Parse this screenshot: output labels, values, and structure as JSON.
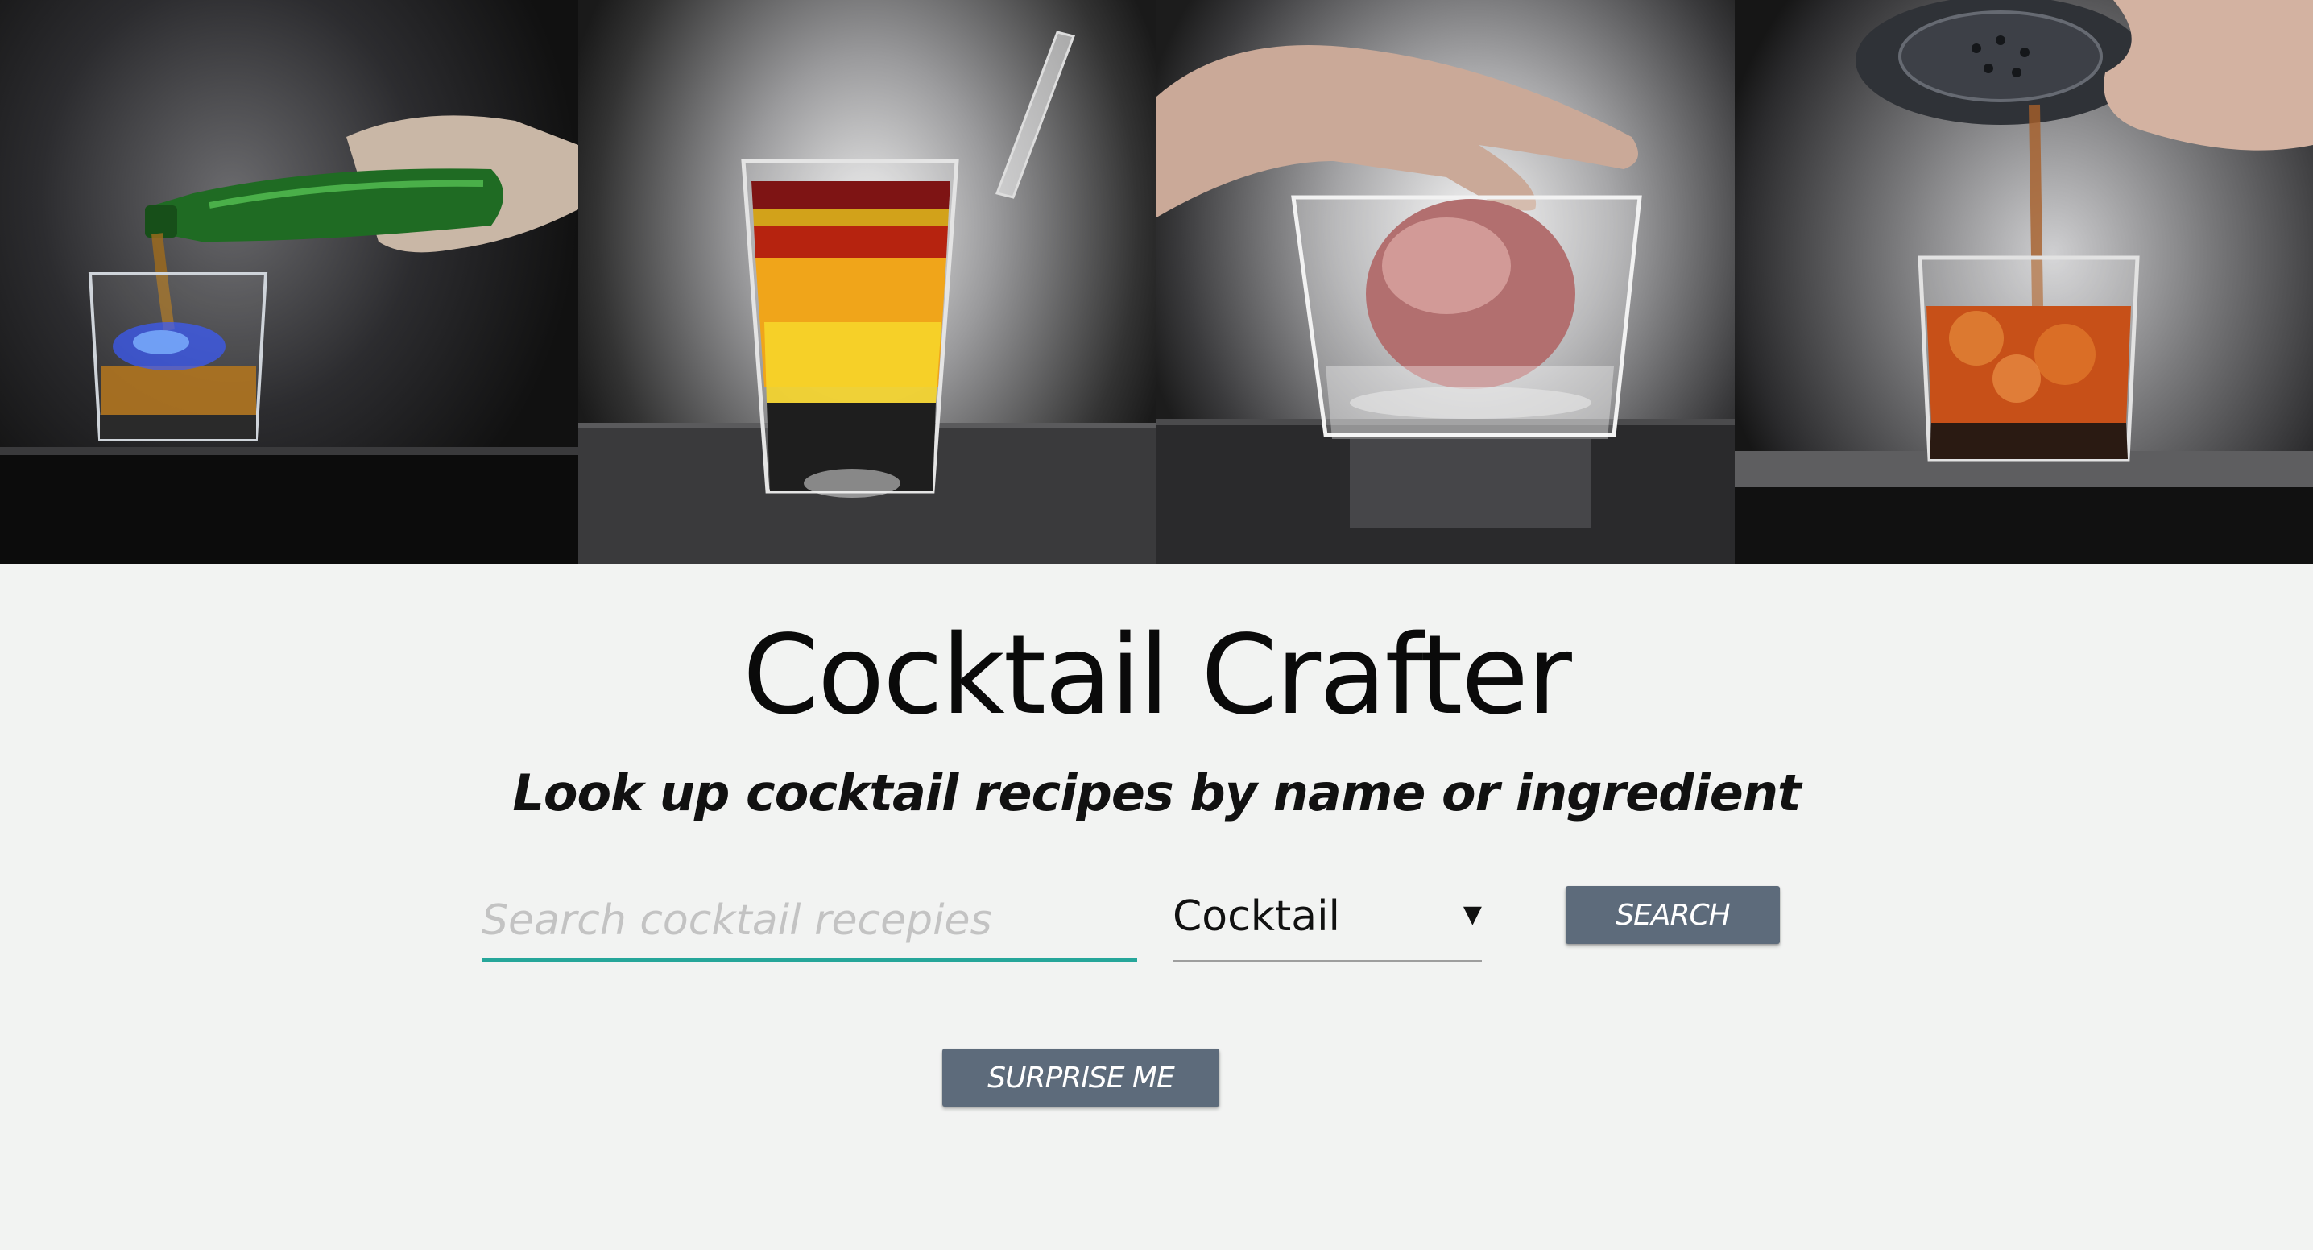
{
  "hero": {
    "photos": [
      {
        "icon": "cocktail-pouring-photo"
      },
      {
        "icon": "layered-shot-photo"
      },
      {
        "icon": "ice-sphere-glass-photo"
      },
      {
        "icon": "straining-cocktail-photo"
      }
    ]
  },
  "header": {
    "title": "Cocktail Crafter",
    "subtitle": "Look up cocktail recipes by name or ingredient"
  },
  "search": {
    "placeholder": "Search cocktail recepies",
    "value": "",
    "type_selected": "Cocktail",
    "button_label": "SEARCH"
  },
  "surprise": {
    "button_label": "SURPRISE ME"
  },
  "colors": {
    "background": "#f2f3f2",
    "accent_underline": "#26a69a",
    "button": "#5d6b7b"
  }
}
